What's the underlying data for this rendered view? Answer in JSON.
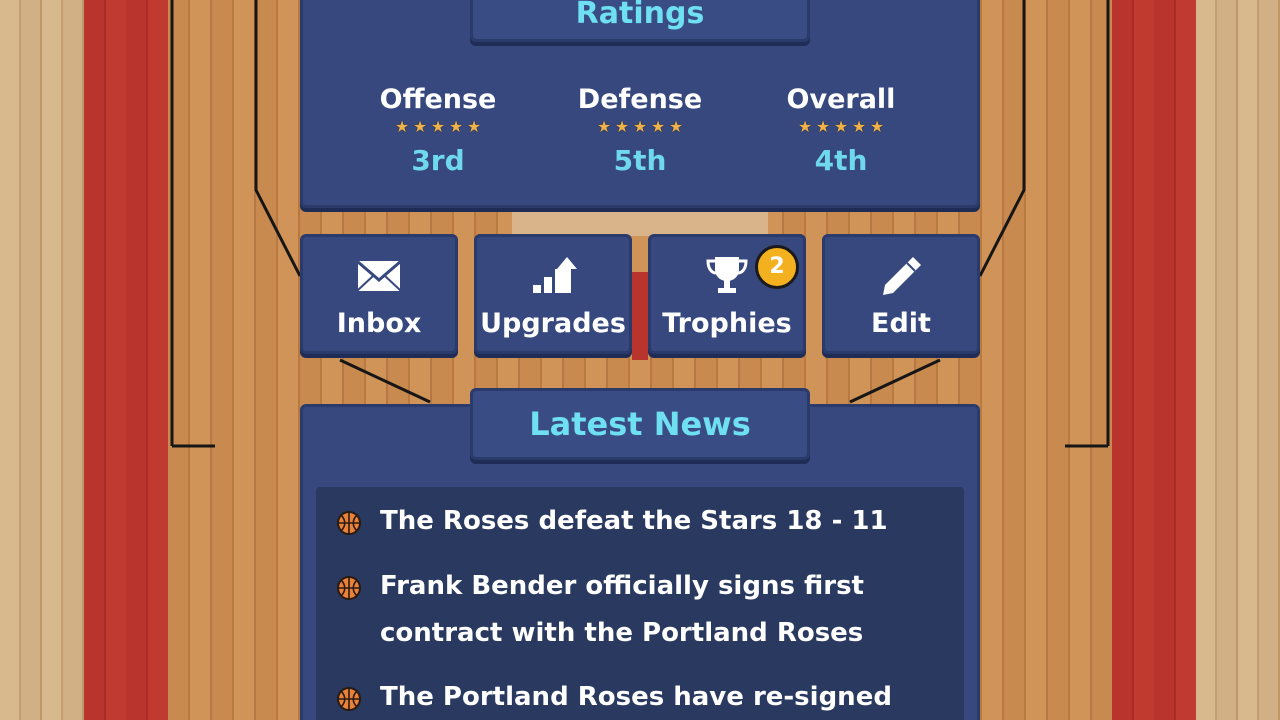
{
  "ratings": {
    "title": "Ratings",
    "items": [
      {
        "label": "Offense",
        "stars": 5,
        "rank": "3rd"
      },
      {
        "label": "Defense",
        "stars": 5,
        "rank": "5th"
      },
      {
        "label": "Overall",
        "stars": 5,
        "rank": "4th"
      }
    ]
  },
  "actions": {
    "inbox": {
      "label": "Inbox",
      "icon": "envelope-icon"
    },
    "upgrades": {
      "label": "Upgrades",
      "icon": "upgrade-chart-icon"
    },
    "trophies": {
      "label": "Trophies",
      "icon": "trophy-icon",
      "badge": "2"
    },
    "edit": {
      "label": "Edit",
      "icon": "pencil-icon"
    }
  },
  "news": {
    "title": "Latest News",
    "items": [
      {
        "text": "The Roses defeat the Stars 18 - 11",
        "icon": "basketball-icon"
      },
      {
        "text": "Frank Bender officially signs first contract with the Portland Roses",
        "icon": "basketball-icon"
      },
      {
        "text": "The Portland Roses have re-signed",
        "icon": "basketball-icon"
      }
    ]
  },
  "colors": {
    "panel": "#36487e",
    "accent_text": "#6fe0f2",
    "badge": "#f4b11f",
    "court_red": "#b8342c",
    "court_wood": "#c98a4f"
  }
}
